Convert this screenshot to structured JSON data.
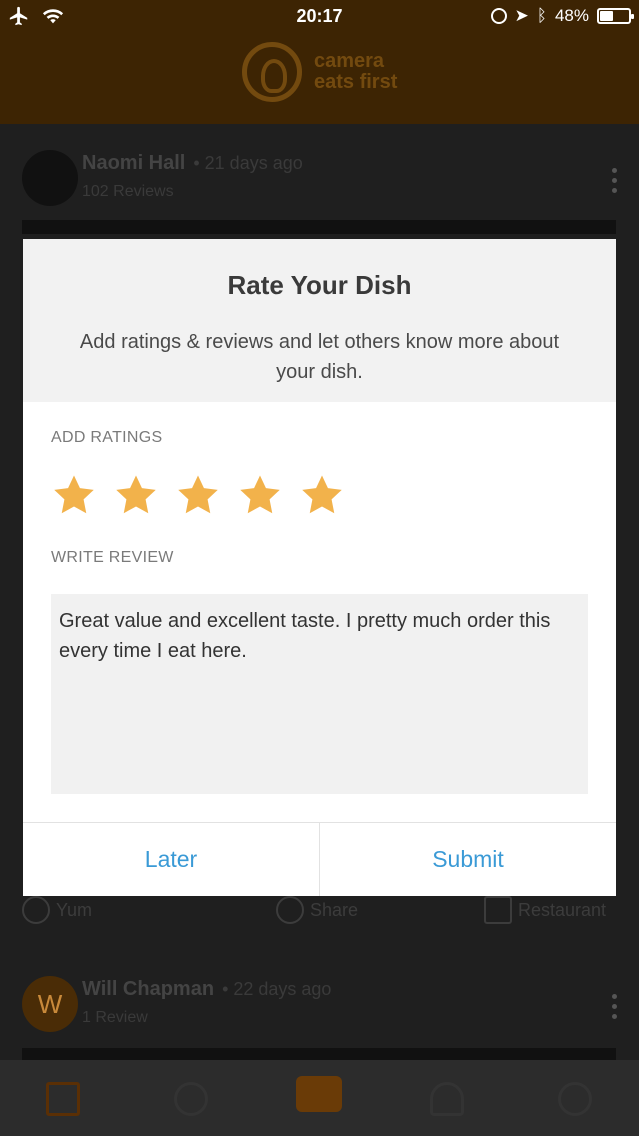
{
  "status_bar": {
    "time": "20:17",
    "battery": "48%",
    "battery_level": 0.48
  },
  "header": {
    "logo_line1": "camera",
    "logo_line2": "eats first"
  },
  "feed": {
    "posts": [
      {
        "name": "Naomi Hall",
        "date": "• 21 days ago",
        "reviews": "102 Reviews"
      },
      {
        "name": "Will Chapman",
        "date": "• 22 days ago",
        "reviews": "1 Review",
        "avatar_letter": "W"
      }
    ],
    "actions": {
      "yum": "Yum",
      "share": "Share",
      "restaurant": "Restaurant"
    }
  },
  "modal": {
    "title": "Rate Your Dish",
    "subtitle": "Add ratings & reviews and let others know more about your dish.",
    "ratings_label": "ADD RATINGS",
    "rating": 5,
    "rating_max": 5,
    "review_label": "WRITE REVIEW",
    "review_text": "Great value and excellent taste. I pretty much order this every time I eat here.",
    "later_label": "Later",
    "submit_label": "Submit"
  },
  "colors": {
    "star": "#f2b24b",
    "link": "#3a9ad6",
    "header_bg": "#3d2403"
  }
}
